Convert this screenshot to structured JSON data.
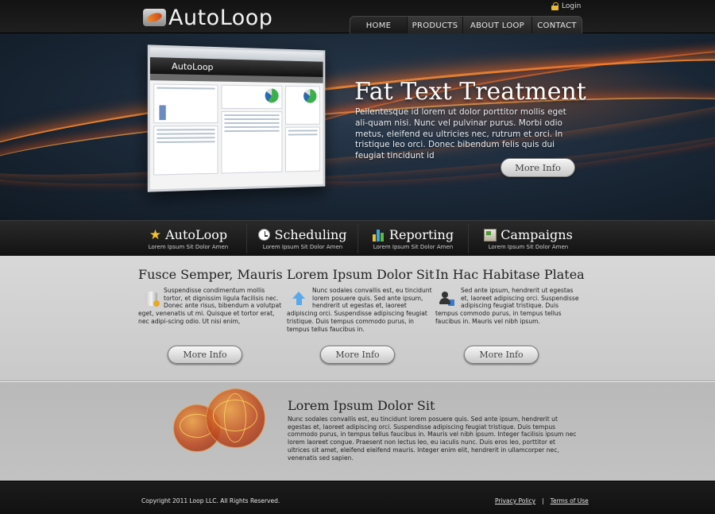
{
  "header": {
    "logo_text": "AutoLoop",
    "login_label": "Login",
    "nav": [
      {
        "label": "HOME"
      },
      {
        "label": "PRODUCTS"
      },
      {
        "label": "ABOUT LOOP"
      },
      {
        "label": "CONTACT"
      }
    ]
  },
  "hero": {
    "title": "Fat Text Treatment",
    "text": "Pellentesque id lorem ut dolor porttitor mollis eget ali-quam nisi. Nunc vel pulvinar purus. Morbi odio metus, eleifend eu ultricies nec, rutrum et orci. In tristique leo orci. Donec bibendum felis quis dui feugiat tincidunt id",
    "button": "More Info",
    "screenshot_logo": "AutoLoop"
  },
  "features": [
    {
      "title": "AutoLoop",
      "subtitle": "Lorem Ipsum Sit Dolor Amen",
      "icon": "star-icon"
    },
    {
      "title": "Scheduling",
      "subtitle": "Lorem Ipsum Sit Dolor Amen",
      "icon": "clock-icon"
    },
    {
      "title": "Reporting",
      "subtitle": "Lorem Ipsum Sit Dolor Amen",
      "icon": "bar-chart-icon"
    },
    {
      "title": "Campaigns",
      "subtitle": "Lorem Ipsum Sit Dolor Amen",
      "icon": "campaign-icon"
    }
  ],
  "columns": [
    {
      "title": "Fusce Semper, Mauris",
      "text": "Suspendisse condimentum mollis tortor, et dignissim ligula facilisis nec. Donec ante risus, bibendum a volutpat eget, venenatis ut mi. Quisque et tortor erat, nec adipi-scing odio. Ut nisi enim,",
      "icon": "database-icon",
      "button": "More Info"
    },
    {
      "title": "Lorem Ipsum Dolor Sit",
      "text": "Nunc sodales convallis est, eu tincidunt lorem posuere quis. Sed ante ipsum, hendrerit ut egestas et, laoreet adipiscing orci. Suspendisse adipiscing feugiat tristique. Duis tempus commodo purus, in tempus tellus faucibus in.",
      "icon": "upload-arrow-icon",
      "button": "More Info"
    },
    {
      "title": "In Hac Habitase Platea",
      "text": "Sed ante ipsum, hendrerit ut egestas et, laoreet adipiscing orci. Suspendisse adipiscing feugiat tristique. Duis tempus commodo purus, in tempus tellus faucibus in. Mauris vel nibh ipsum.",
      "icon": "user-icon",
      "button": "More Info"
    }
  ],
  "lower": {
    "title": "Lorem Ipsum Dolor Sit",
    "text": "Nunc sodales convallis est, eu tincidunt lorem posuere quis. Sed ante ipsum, hendrerit ut egestas et, laoreet adipiscing orci. Suspendisse adipiscing feugiat tristique. Duis tempus commodo purus, in tempus tellus faucibus in. Mauris vel nibh ipsum. Integer facilisis ipsum nec lorem laoreet congue. Praesent non lectus leo, eu iaculis nunc. Duis eros leo, porttitor et ultrices sit amet, eleifend eleifend mauris. Integer enim elit, hendrerit in ullamcorper nec, venenatis sed sapien."
  },
  "footer": {
    "copyright": "Copyright 2011 Loop LLC. All Rights Reserved.",
    "privacy": "Privacy Policy",
    "separator": "|",
    "terms": "Terms of Use"
  },
  "colors": {
    "accent_orange": "#f08a2a",
    "dark_bar": "#1a1a1a",
    "light_panel": "#d2d2d2"
  }
}
